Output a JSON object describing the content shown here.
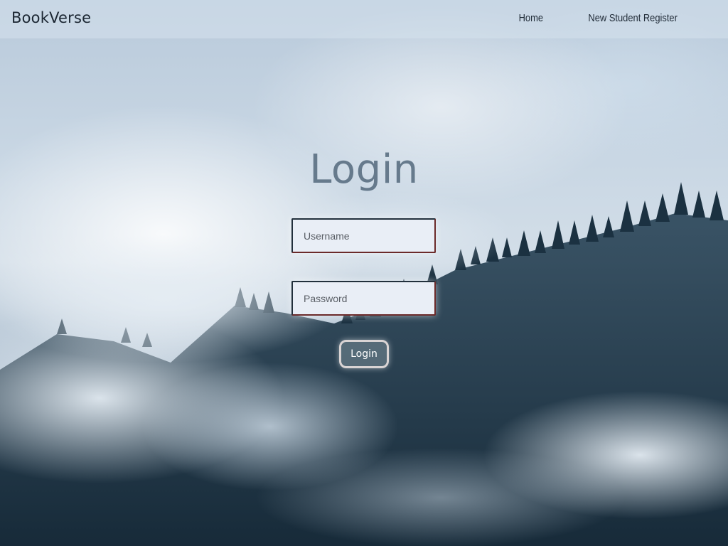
{
  "navbar": {
    "brand": "BookVerse",
    "links": [
      {
        "label": "Home"
      },
      {
        "label": "New Student Register"
      }
    ]
  },
  "login": {
    "title": "Login",
    "username_placeholder": "Username",
    "password_placeholder": "Password",
    "submit_label": "Login"
  },
  "background": {
    "description_colors": {
      "sky": "#c9d7e4",
      "forest": "#1c3344",
      "mist": "#d3dee8"
    }
  }
}
